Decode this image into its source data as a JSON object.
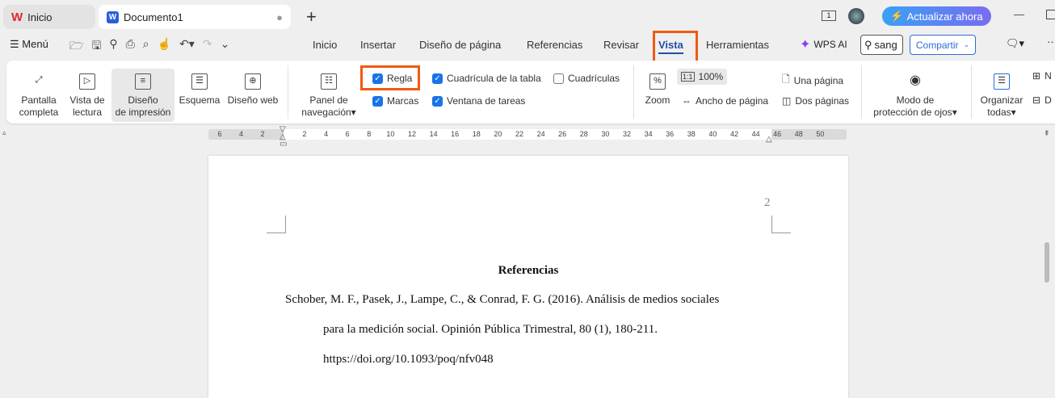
{
  "tabs": [
    {
      "label": "Inicio"
    },
    {
      "label": "Documento1"
    }
  ],
  "titlebar": {
    "update_label": "Actualizar ahora",
    "window_count": "1"
  },
  "toolbar": {
    "menu_label": "Menú"
  },
  "menu_tabs": [
    "Inicio",
    "Insertar",
    "Diseño de página",
    "Referencias",
    "Revisar",
    "Vista",
    "Herramientas"
  ],
  "active_tab": "Vista",
  "wps_ai": "WPS AI",
  "search": {
    "value": "sang"
  },
  "share_label": "Compartir",
  "ribbon": {
    "views": [
      {
        "l1": "Pantalla",
        "l2": "completa"
      },
      {
        "l1": "Vista de",
        "l2": "lectura"
      },
      {
        "l1": "Diseño",
        "l2": "de impresión"
      },
      {
        "l1": "Esquema",
        "l2": ""
      },
      {
        "l1": "Diseño web",
        "l2": ""
      }
    ],
    "nav_panel": {
      "l1": "Panel de",
      "l2": "navegación"
    },
    "checks": [
      {
        "label": "Regla",
        "checked": true
      },
      {
        "label": "Marcas",
        "checked": true
      },
      {
        "label": "Cuadrícula de la tabla",
        "checked": true
      },
      {
        "label": "Ventana de tareas",
        "checked": true
      },
      {
        "label": "Cuadrículas",
        "checked": false
      }
    ],
    "zoom_label": "Zoom",
    "zoom_value": "100%",
    "page_width": "Ancho de página",
    "one_page": "Una página",
    "two_pages": "Dos páginas",
    "eye": {
      "l1": "Modo de",
      "l2": "protección de ojos"
    },
    "arrange": {
      "l1": "Organizar",
      "l2": "todas"
    },
    "new_cut": "N",
    "split_cut": "D"
  },
  "ruler_ticks": [
    "6",
    "4",
    "2",
    "2",
    "4",
    "6",
    "8",
    "10",
    "12",
    "14",
    "16",
    "18",
    "20",
    "22",
    "24",
    "26",
    "28",
    "30",
    "32",
    "34",
    "36",
    "38",
    "40",
    "42",
    "44",
    "46",
    "48",
    "50"
  ],
  "document": {
    "page_number": "2",
    "heading": "Referencias",
    "lines": [
      "Schober, M. F., Pasek, J., Lampe, C., & Conrad, F. G. (2016). Análisis de medios sociales",
      "para la medición social. Opinión Pública Trimestral, 80 (1), 180-211.",
      "https://doi.org/10.1093/poq/nfv048"
    ]
  }
}
